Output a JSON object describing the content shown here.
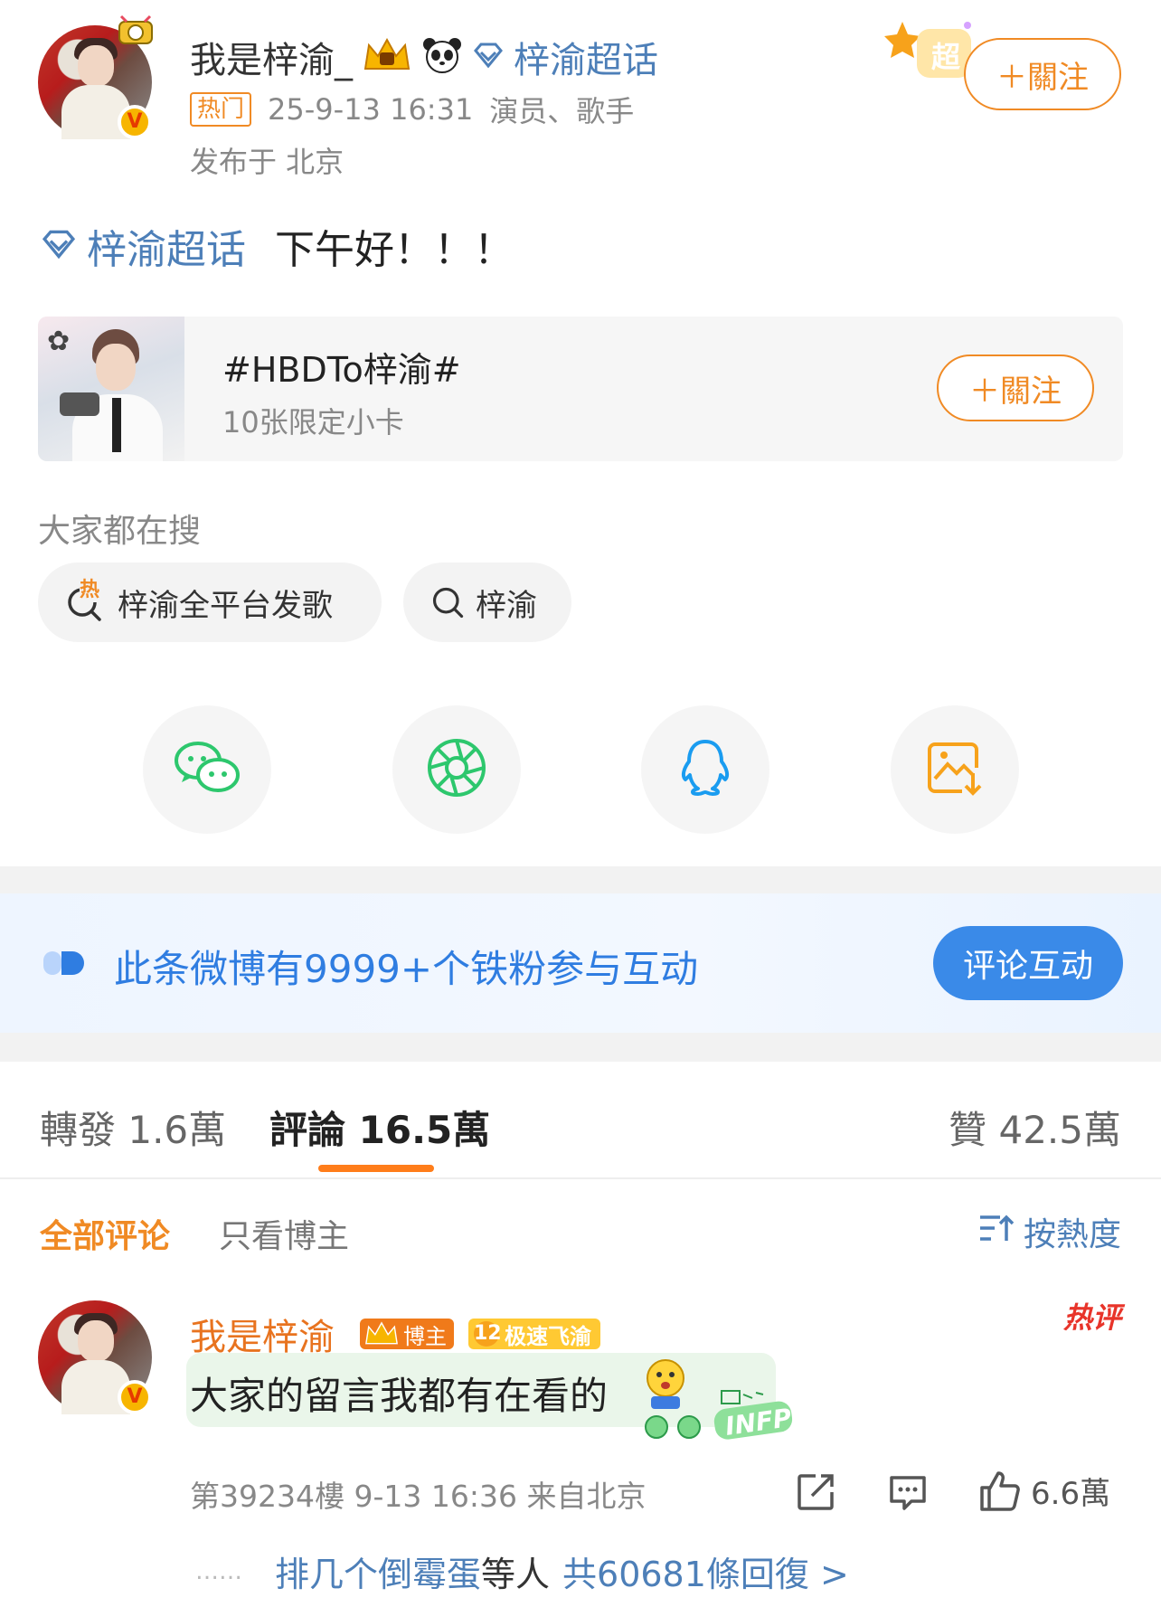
{
  "post": {
    "author_name": "我是梓渝_",
    "super_topic_link": "梓渝超话",
    "hot_tag": "热门",
    "timestamp": "25-9-13 16:31",
    "author_role": "演员、歌手",
    "location": "发布于 北京",
    "follow_label": "＋關注",
    "body_topic": "梓渝超话",
    "body_text": "下午好！！！",
    "super_badge": "超"
  },
  "topic_card": {
    "title": "#HBDTo梓渝#",
    "subtitle": "10张限定小卡",
    "follow_label": "＋關注"
  },
  "search": {
    "heading": "大家都在搜",
    "chips": [
      {
        "label": "梓渝全平台发歌",
        "hot_mark": "热"
      },
      {
        "label": "梓渝"
      }
    ]
  },
  "share": {
    "icons": [
      "wechat-icon",
      "moments-icon",
      "qq-icon",
      "save-image-icon"
    ],
    "colors": {
      "wechat": "#2dc76d",
      "moments": "#2dc76d",
      "qq": "#1a9cf0",
      "save": "#f7a21b"
    }
  },
  "fans_banner": {
    "text": "此条微博有9999+个铁粉参与互动",
    "button": "评论互动"
  },
  "stats_tabs": {
    "repost": "轉發 1.6萬",
    "comments": "評論 16.5萬",
    "likes": "贊 42.5萬"
  },
  "comment_filter": {
    "all": "全部评论",
    "author_only": "只看博主",
    "sort": "按熱度"
  },
  "comment": {
    "author_name": "我是梓渝_",
    "badge_blogger": "博主",
    "badge_level": "12",
    "badge_fan": "极速飞渝",
    "hot_label": "热评",
    "text": "大家的留言我都有在看的",
    "sticker_text": "INFP",
    "floor_meta": "第39234樓 9-13 16:36 来自北京",
    "like_count": "6.6萬",
    "reply_prefix": "……",
    "reply_names": "排几个倒霉蛋",
    "reply_mid": "等人",
    "reply_total": "共60681條回復 >"
  },
  "colors": {
    "accent_orange": "#f08a24",
    "link_blue": "#4d7fb8",
    "banner_blue": "#2f7de1"
  }
}
